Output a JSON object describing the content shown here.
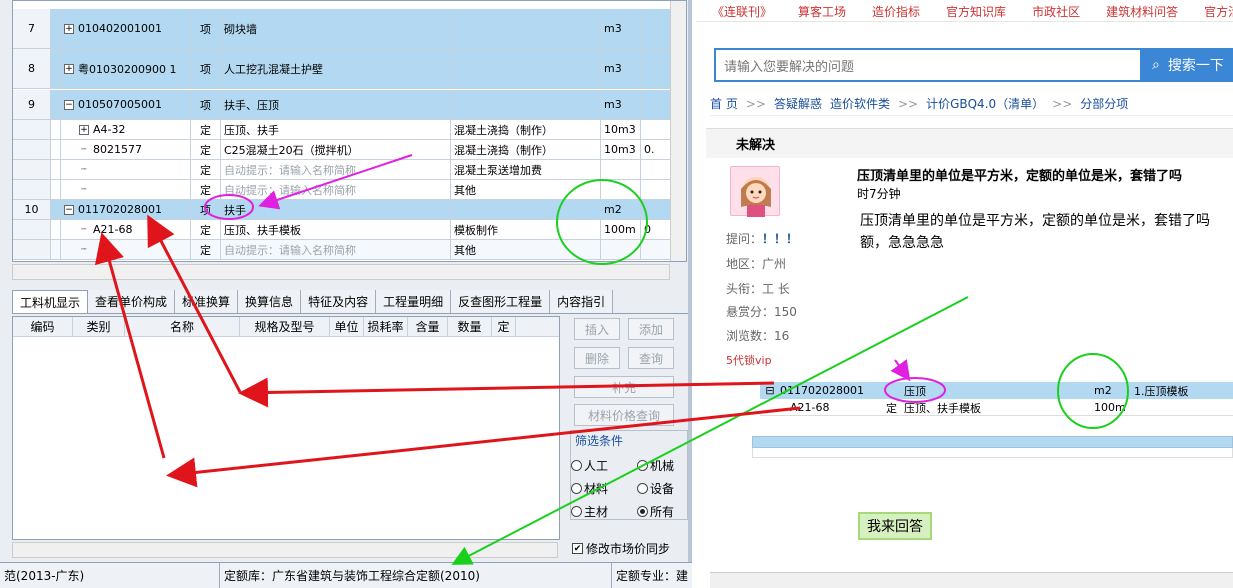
{
  "grid": {
    "rows": [
      {
        "num": "7",
        "code": "010402001001",
        "type": "项",
        "name": "砌块墙",
        "feature": "",
        "unit": "m3",
        "extra": ""
      },
      {
        "num": "8",
        "code": "粤01030200900 1",
        "type": "项",
        "name": "人工挖孔混凝土护壁",
        "feature": "",
        "unit": "m3",
        "extra": ""
      },
      {
        "num": "9",
        "code": "010507005001",
        "type": "项",
        "name": "扶手、压顶",
        "feature": "",
        "unit": "m3",
        "extra": ""
      },
      {
        "num": "",
        "code": "A4-32",
        "type": "定",
        "name": "压顶、扶手",
        "feature": "混凝土浇捣（制作）",
        "unit": "10m3",
        "extra": ""
      },
      {
        "num": "",
        "code": "8021577",
        "type": "定",
        "name": "C25混凝土20石（搅拌机）",
        "feature": "混凝土浇捣（制作）",
        "unit": "10m3",
        "extra": "0."
      },
      {
        "num": "",
        "code": "",
        "type": "定",
        "name": "自动提示：请输入名称简称",
        "feature": "混凝土泵送增加费",
        "unit": "",
        "extra": ""
      },
      {
        "num": "",
        "code": "",
        "type": "定",
        "name": "自动提示：请输入名称简称",
        "feature": "其他",
        "unit": "",
        "extra": ""
      },
      {
        "num": "10",
        "code": "011702028001",
        "type": "项",
        "name": "扶手",
        "feature": "",
        "unit": "m2",
        "extra": ""
      },
      {
        "num": "",
        "code": "A21-68",
        "type": "定",
        "name": "压顶、扶手模板",
        "feature": "模板制作",
        "unit": "100m",
        "extra": "0"
      },
      {
        "num": "",
        "code": "",
        "type": "定",
        "name": "自动提示：请输入名称简称",
        "feature": "其他",
        "unit": "",
        "extra": ""
      }
    ]
  },
  "tabs": [
    "工料机显示",
    "查看单价构成",
    "标准换算",
    "换算信息",
    "特征及内容",
    "工程量明细",
    "反查图形工程量",
    "内容指引"
  ],
  "lower_table": {
    "headers": [
      "编码",
      "类别",
      "名称",
      "规格及型号",
      "单位",
      "损耗率",
      "含量",
      "数量",
      "定"
    ]
  },
  "buttons": {
    "insert": "插入",
    "add": "添加",
    "delete": "删除",
    "query": "查询",
    "supplement": "补充",
    "price_query": "材料价格查询"
  },
  "filter": {
    "title": "筛选条件",
    "options": [
      "人工",
      "机械",
      "材料",
      "设备",
      "主材",
      "所有"
    ],
    "selected": "所有"
  },
  "sync_label": "修改市场价同步",
  "status": {
    "left": "范(2013-广东)",
    "library": "定额库：广东省建筑与装饰工程综合定额(2010)",
    "specialty": "定额专业：建"
  },
  "forum": {
    "nav": [
      "《连联刊》",
      "算客工场",
      "造价指标",
      "官方知识库",
      "市政社区",
      "建筑材料问答",
      "官方活动"
    ],
    "search_placeholder": "请输入您要解决的问题",
    "search_button": "搜索一下",
    "breadcrumb": [
      "首 页",
      ">>",
      "答疑解惑",
      "造价软件类",
      ">>",
      "计价GBQ4.0（清单）",
      ">>",
      "分部分项"
    ],
    "status": "未解决",
    "question_title": "压顶清单里的单位是平方米，定额的单位是米，套错了吗",
    "time": "时7分钟",
    "question_body": "压顶清单里的单位是平方米，定额的单位是米，套错了吗额，急急急急",
    "asker": {
      "label": "提问：",
      "name": "！！！"
    },
    "region": "地区：广州",
    "rank": "头衔：工 长",
    "bounty": "悬赏分：150",
    "views": "浏览数：16",
    "vip": "5代锁vip",
    "shot_row1": {
      "code": "011702028001",
      "name": "压顶",
      "unit": "m2",
      "feature": "1.压顶模板"
    },
    "shot_row2": {
      "code": "A21-68",
      "type": "定",
      "name": "压顶、扶手模板",
      "unit": "100m"
    },
    "answer_button": "我来回答"
  }
}
